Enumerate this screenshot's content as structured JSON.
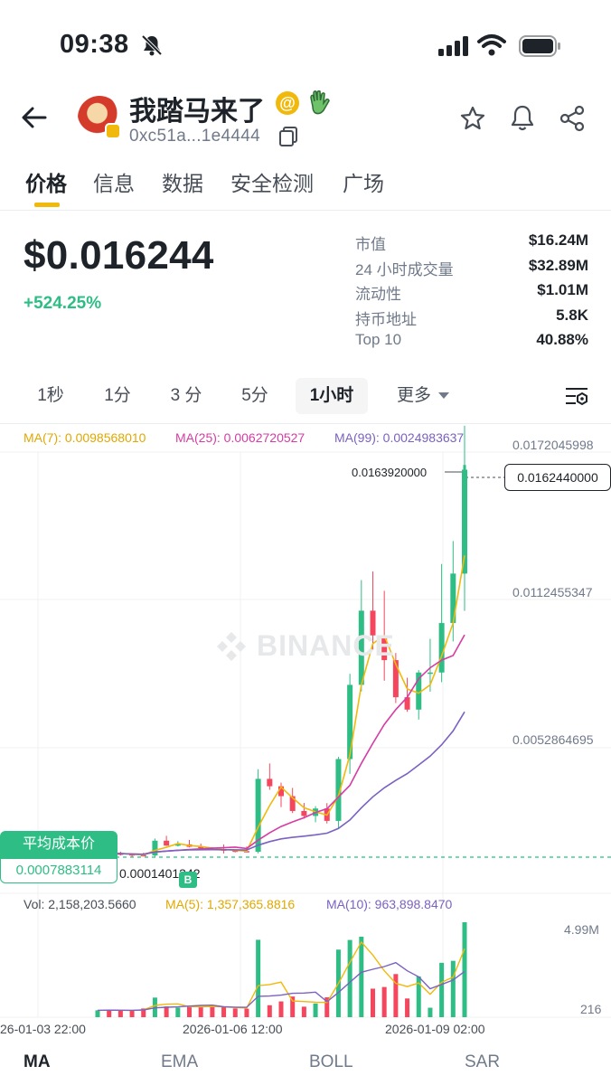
{
  "status_bar": {
    "time": "09:38"
  },
  "header": {
    "token_name": "我踏马来了",
    "at_symbol": "@",
    "address": "0xc51a...1e4444"
  },
  "tabs": [
    "价格",
    "信息",
    "数据",
    "安全检测",
    "广场"
  ],
  "price": {
    "value": "$0.016244",
    "change": "+524.25%"
  },
  "stats": [
    {
      "label": "市值",
      "value": "$16.24M"
    },
    {
      "label": "24 小时成交量",
      "value": "$32.89M"
    },
    {
      "label": "流动性",
      "value": "$1.01M"
    },
    {
      "label": "持币地址",
      "value": "5.8K"
    },
    {
      "label": "Top 10",
      "value": "40.88%"
    }
  ],
  "intervals": {
    "items": [
      "1秒",
      "1分",
      "3 分",
      "5分",
      "1小时"
    ],
    "more": "更多",
    "active": "1小时"
  },
  "chart_ma": {
    "ma7": "MA(7): 0.0098568010",
    "ma25": "MA(25): 0.0062720527",
    "ma99": "MA(99): 0.0024983637"
  },
  "price_axis": [
    "0.0172045998",
    "0.0112455347",
    "0.0052864695"
  ],
  "current_price_tag": "0.0162440000",
  "high_label": "0.0163920000",
  "low_label": "0.0001401342",
  "avg_cost": {
    "title": "平均成本价",
    "value": "0.0007883114"
  },
  "buy_marker": "B",
  "watermark": "BINANCE",
  "volume": {
    "vol": "Vol: 2,158,203.5660",
    "ma5": "MA(5): 1,357,365.8816",
    "ma10": "MA(10): 963,898.8470",
    "axis_top": "4.99M",
    "axis_bottom": "216"
  },
  "dates": [
    "26-01-03 22:00",
    "2026-01-06 12:00",
    "2026-01-09 02:00"
  ],
  "indicators": [
    "MA",
    "EMA",
    "BOLL",
    "SAR"
  ],
  "colors": {
    "up": "#2ebd85",
    "down": "#f6465d",
    "ma7": "#f0b90b",
    "ma25": "#d63ca3",
    "ma99": "#7b61c2",
    "accent": "#f0b90b"
  },
  "chart_data": {
    "type": "candlestick",
    "price_axis_ticks": [
      0.0172045998,
      0.0112455347,
      0.0052864695
    ],
    "high": 0.016392,
    "low": 0.0001401342,
    "current": 0.016244,
    "avg_cost": 0.0007883114,
    "volume_axis": [
      "4.99M",
      "216"
    ],
    "x_ticks": [
      "26-01-03 22:00",
      "2026-01-06 12:00",
      "2026-01-09 02:00"
    ],
    "series": [
      {
        "name": "MA(7)",
        "last": 0.009856801
      },
      {
        "name": "MA(25)",
        "last": 0.0062720527
      },
      {
        "name": "MA(99)",
        "last": 0.0024983637
      }
    ],
    "approx_close_path": [
      0.0007,
      0.00068,
      0.00065,
      0.00062,
      0.0006,
      0.0012,
      0.001,
      0.00105,
      0.00095,
      0.0009,
      0.00085,
      0.0008,
      0.00078,
      0.00075,
      0.0037,
      0.0034,
      0.003,
      0.0024,
      0.0022,
      0.0025,
      0.002,
      0.0045,
      0.0075,
      0.0105,
      0.0095,
      0.0085,
      0.007,
      0.0065,
      0.008,
      0.008,
      0.01,
      0.012,
      0.0162
    ]
  }
}
